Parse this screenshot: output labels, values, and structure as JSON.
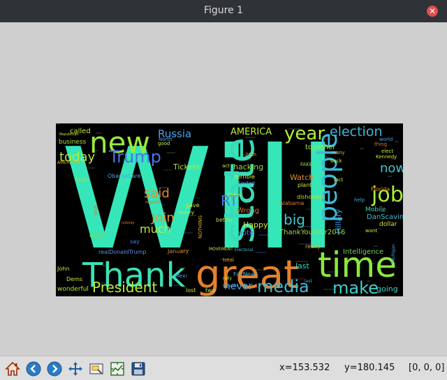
{
  "window": {
    "title": "Figure 1"
  },
  "status": {
    "x_readout": "x=153.532",
    "y_readout": "y=180.145",
    "pixel_value": "[0, 0, 0]"
  },
  "toolbar": {
    "buttons": [
      {
        "name": "home-button",
        "icon": "home-icon"
      },
      {
        "name": "back-button",
        "icon": "arrow-left-icon"
      },
      {
        "name": "forward-button",
        "icon": "arrow-right-icon"
      },
      {
        "name": "pan-button",
        "icon": "move-icon"
      },
      {
        "name": "zoom-button",
        "icon": "zoom-rect-icon"
      },
      {
        "name": "subplots-button",
        "icon": "subplots-icon"
      },
      {
        "name": "save-button",
        "icon": "floppy-disk-icon"
      }
    ]
  },
  "colors": {
    "window_bg": "#cfcfcf",
    "titlebar": "#2f3237",
    "cloud_bg": "#000000",
    "teal": "#33e0b5",
    "lime": "#a6ef3a",
    "orange": "#e07d2a",
    "blue": "#4e7be8",
    "cyan": "#3fb8d8"
  },
  "wordcloud": {
    "words": [
      {
        "text": "Will",
        "color": "#35e6b9"
      },
      {
        "text": "great",
        "color": "#e3812b"
      },
      {
        "text": "Thank",
        "color": "#3ae2b5"
      },
      {
        "text": "time",
        "color": "#8ae93f"
      },
      {
        "text": "state",
        "color": "#37dbb8"
      },
      {
        "text": "new",
        "color": "#99ea3d"
      },
      {
        "text": "people",
        "color": "#3cb9da"
      },
      {
        "text": "job",
        "color": "#a8ef37"
      },
      {
        "text": "year",
        "color": "#b7ee35"
      },
      {
        "text": "election",
        "color": "#3fb6d9"
      },
      {
        "text": "media",
        "color": "#3fbcd9"
      },
      {
        "text": "make",
        "color": "#42d0c9"
      },
      {
        "text": "President",
        "color": "#b8ef34"
      },
      {
        "text": "Trump",
        "color": "#4a72e8"
      },
      {
        "text": "Russia",
        "color": "#4aa0e3"
      },
      {
        "text": "today",
        "color": "#b6ea3a"
      },
      {
        "text": "now",
        "color": "#3ec3d1"
      },
      {
        "text": "big",
        "color": "#43c9cf"
      },
      {
        "text": "said",
        "color": "#e38a2d"
      },
      {
        "text": "Join",
        "color": "#d99a2e"
      },
      {
        "text": "much",
        "color": "#b9ea3c"
      },
      {
        "text": "AMERICA",
        "color": "#c2e83a"
      },
      {
        "text": "RT",
        "color": "#4b7be9"
      },
      {
        "text": "never",
        "color": "#4ba6e1"
      },
      {
        "text": "Hillary",
        "color": "#3d9fe0"
      },
      {
        "text": "Tickets",
        "color": "#b0e83b"
      },
      {
        "text": "hacking",
        "color": "#90d946"
      },
      {
        "text": "together",
        "color": "#a4e43c"
      },
      {
        "text": "Watch",
        "color": "#e38a2d"
      },
      {
        "text": "ThankYouTour2016",
        "color": "#9bdc40"
      },
      {
        "text": "Happy",
        "color": "#d0e43a"
      },
      {
        "text": "Wrong",
        "color": "#e0762b"
      },
      {
        "text": "vote",
        "color": "#4b7be9"
      },
      {
        "text": "last",
        "color": "#3fd2c8"
      },
      {
        "text": "Intelligence",
        "color": "#6fd25a"
      },
      {
        "text": "DanScavino",
        "color": "#3fbcd3"
      },
      {
        "text": "Mobile",
        "color": "#3ed2c6"
      },
      {
        "text": "Alabama",
        "color": "#e07a2c"
      },
      {
        "text": "dollar",
        "color": "#d0e53a"
      },
      {
        "text": "going",
        "color": "#3fd0c6"
      },
      {
        "text": "wonderful",
        "color": "#b0e83b"
      },
      {
        "text": "realDonaldTrump",
        "color": "#5b8fe0"
      },
      {
        "text": "ObamaCare",
        "color": "#4ba6e1"
      },
      {
        "text": "called",
        "color": "#c7e93a"
      },
      {
        "text": "business",
        "color": "#a7e33c"
      },
      {
        "text": "look",
        "color": "#a0e041"
      },
      {
        "text": "build",
        "color": "#8cd646"
      },
      {
        "text": "John",
        "color": "#c7e93a"
      },
      {
        "text": "Dems",
        "color": "#c7e93a"
      },
      {
        "text": "FAKE",
        "color": "#9bdc40"
      },
      {
        "text": "plant",
        "color": "#c7e93a"
      },
      {
        "text": "dishonest",
        "color": "#b0e83b"
      },
      {
        "text": "really",
        "color": "#e0b12d"
      },
      {
        "text": "better",
        "color": "#b0e83b"
      },
      {
        "text": "gave",
        "color": "#c7e93a"
      },
      {
        "text": "report",
        "color": "#e07a2c"
      },
      {
        "text": "January",
        "color": "#e08a2c"
      },
      {
        "text": "lost",
        "color": "#c7e93a"
      },
      {
        "text": "two",
        "color": "#c7e93a"
      },
      {
        "text": "FoxNews",
        "color": "#3fbcd3"
      },
      {
        "text": "United",
        "color": "#4ba6e1"
      },
      {
        "text": "terrible",
        "color": "#d9e43a"
      },
      {
        "text": "20th",
        "color": "#e0b12d"
      },
      {
        "text": "act",
        "color": "#c7e93a"
      },
      {
        "text": "China",
        "color": "#c7e93a"
      },
      {
        "text": "good",
        "color": "#c7e93a"
      },
      {
        "text": "money",
        "color": "#c7e93a"
      },
      {
        "text": "North",
        "color": "#4ba6e1"
      },
      {
        "text": "Florida",
        "color": "#e08a2c"
      },
      {
        "text": "elect",
        "color": "#c7e93a"
      },
      {
        "text": "Kennedy",
        "color": "#c7e93a"
      },
      {
        "text": "thing",
        "color": "#e0762b"
      },
      {
        "text": "world",
        "color": "#4ba6e1"
      },
      {
        "text": "fact",
        "color": "#c7e93a"
      },
      {
        "text": "back",
        "color": "#c7e93a"
      },
      {
        "text": "many",
        "color": "#e0b12d"
      },
      {
        "text": "help",
        "color": "#4ba6e1"
      },
      {
        "text": "want",
        "color": "#c7e93a"
      },
      {
        "text": "one",
        "color": "#e0762b"
      },
      {
        "text": "say",
        "color": "#4b7be9"
      },
      {
        "text": "Mexi",
        "color": "#4ba6e1"
      },
      {
        "text": "total",
        "color": "#e0b12d"
      },
      {
        "text": "NOTHING",
        "color": "#e0b12d"
      },
      {
        "text": "MOVEMENT",
        "color": "#c7e93a"
      },
      {
        "text": "AMERICAN",
        "color": "#e0b12d"
      },
      {
        "text": "Michigan",
        "color": "#4ba6e1"
      },
      {
        "text": "Electoral",
        "color": "#3fbcd3"
      },
      {
        "text": "rally",
        "color": "#c7e93a"
      },
      {
        "text": "Wiscon",
        "color": "#4ba6e1"
      },
      {
        "text": "Republican",
        "color": "#c7e93a"
      },
      {
        "text": "nobody",
        "color": "#e0762b"
      },
      {
        "text": "last",
        "color": "#4ba6e1"
      }
    ]
  }
}
